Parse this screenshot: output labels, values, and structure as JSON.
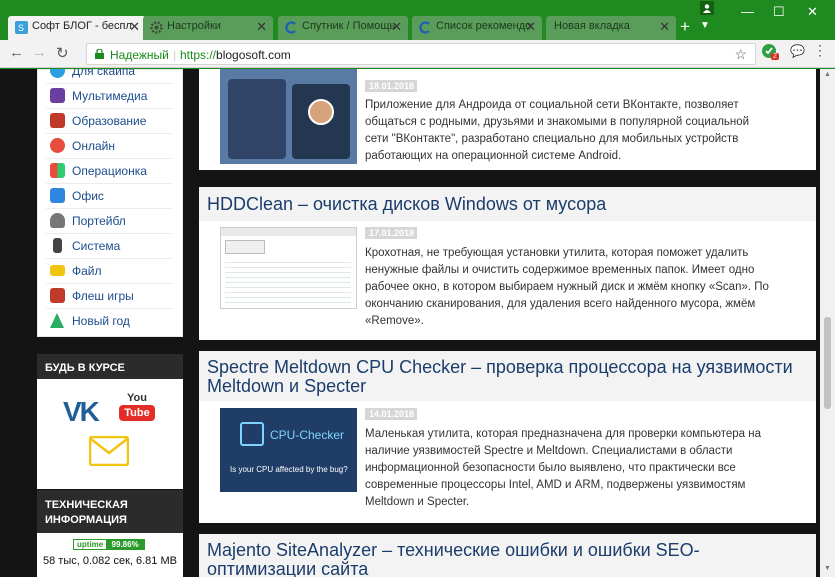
{
  "browser": {
    "tabs": [
      {
        "label": "Софт БЛОГ - беспл",
        "active": true
      },
      {
        "label": "Настройки",
        "active": false
      },
      {
        "label": "Спутник / Помощь",
        "active": false
      },
      {
        "label": "Список рекомендо",
        "active": false
      },
      {
        "label": "Новая вкладка",
        "active": false
      }
    ],
    "new_tab": "+",
    "security": "Надежный",
    "url_scheme": "https://",
    "url_host": "blogosoft.com",
    "ext_badge": "2"
  },
  "sidebar": {
    "items": [
      {
        "label": "Для скайпа",
        "color": "#2aa0e0"
      },
      {
        "label": "Мультимедиа",
        "color": "#6b3fa0"
      },
      {
        "label": "Образование",
        "color": "#c0392b"
      },
      {
        "label": "Онлайн",
        "color": "#e74c3c"
      },
      {
        "label": "Операционка",
        "color": "#e67e22"
      },
      {
        "label": "Офис",
        "color": "#2e86de"
      },
      {
        "label": "Портейбл",
        "color": "#555555"
      },
      {
        "label": "Система",
        "color": "#444444"
      },
      {
        "label": "Файл",
        "color": "#f1c40f"
      },
      {
        "label": "Флеш игры",
        "color": "#c0392b"
      },
      {
        "label": "Новый год",
        "color": "#27ae60"
      }
    ],
    "widget_follow": "БУДЬ В КУРСЕ",
    "widget_tech": "ТЕХНИЧЕСКАЯ ИНФОРМАЦИЯ",
    "uptime_label": "uptime",
    "uptime_value": "99.86%",
    "stats": "58 тыс, 0.082 сек, 6.81 МВ",
    "social": {
      "vk": "VK",
      "youtube_you": "You",
      "youtube_tube": "Tube"
    }
  },
  "posts": [
    {
      "title": "",
      "date": "18.01.2018",
      "desc": "Приложение для Андроида от социальной сети ВКонтакте, позволяет общаться с родными, друзьями и знакомыми в популярной социальной сети \"ВКонтакте\", разработано специально для мобильных устройств работающих на операционной системе Android."
    },
    {
      "title": "HDDClean – очистка дисков Windows от мусора",
      "date": "17.01.2018",
      "desc": "Крохотная, не требующая установки утилита, которая поможет удалить ненужные файлы и очистить содержимое временных папок. Имеет одно рабочее окно, в котором выбираем нужный диск и жмём кнопку «Scan». По окончанию сканирования, для удаления всего найденного мусора, жмём «Remove»."
    },
    {
      "title": "Spectre Meltdown CPU Checker – проверка процессора на уязвимости Meltdown и Specter",
      "date": "14.01.2018",
      "desc": "Маленькая утилита, которая предназначена для проверки компьютера на наличие уязвимостей Spectre и Meltdown. Специалистами в области информационной безопасности было выявлено, что практически все современные процессоры Intel, AMD и ARM, подвержены уязвимостям Meltdown и Specter.",
      "img_text1": "CPU-Checker",
      "img_text2": "Is your CPU affected by the bug?"
    },
    {
      "title": "Majento SiteAnalyzer – технические ошибки и ошибки SEO-оптимизации сайта",
      "date": "",
      "desc": ""
    }
  ]
}
